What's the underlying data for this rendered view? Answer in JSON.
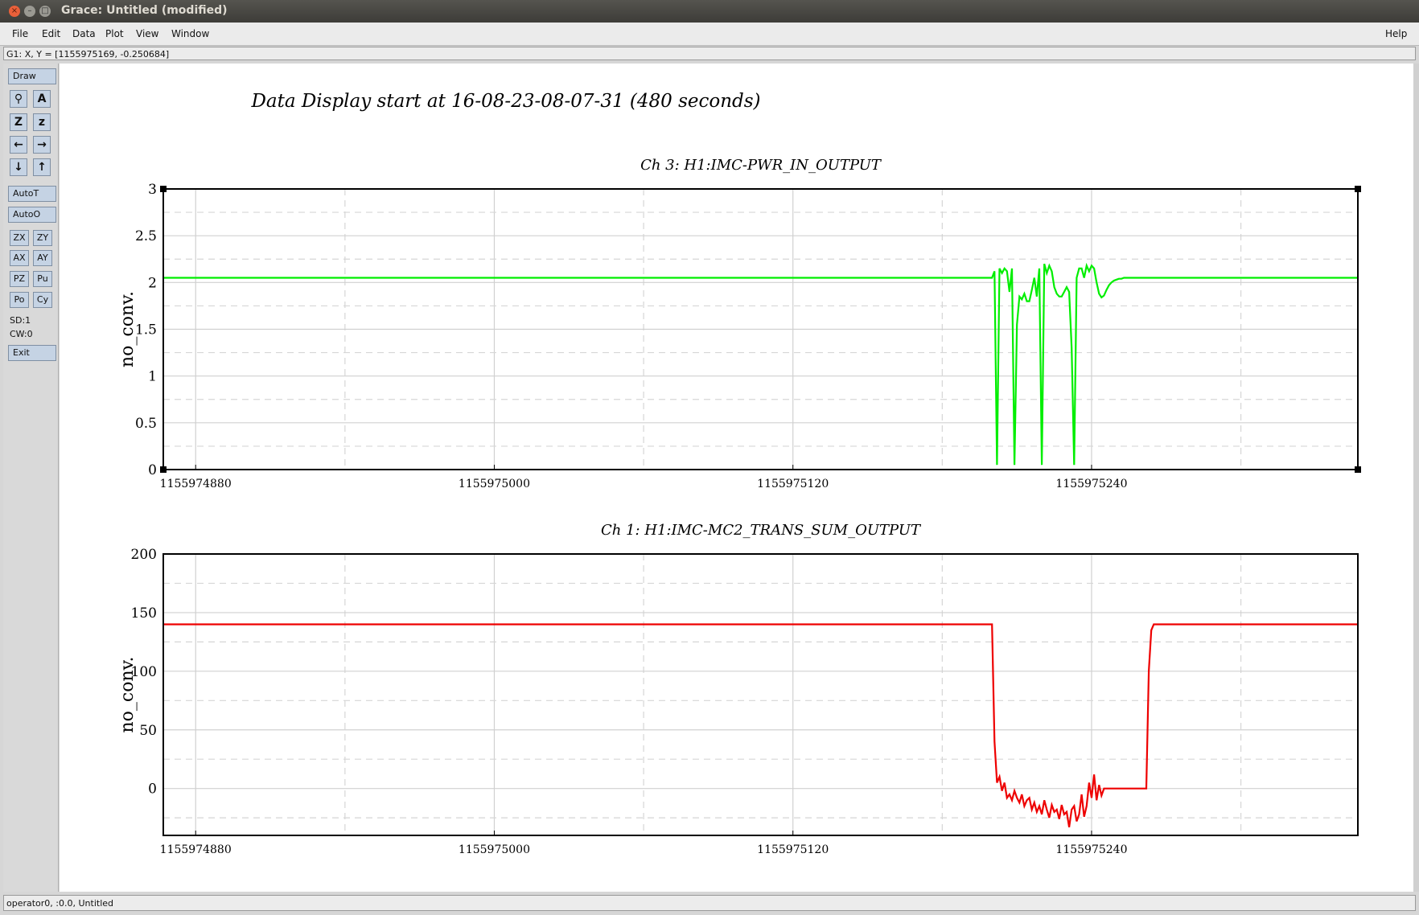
{
  "window": {
    "title": "Grace: Untitled (modified)"
  },
  "menu": {
    "items": [
      "File",
      "Edit",
      "Data",
      "Plot",
      "View",
      "Window"
    ],
    "help": "Help"
  },
  "coords": {
    "text": "G1: X, Y = [1155975169, -0.250684]"
  },
  "toolbar": {
    "draw": "Draw",
    "autot": "AutoT",
    "autoo": "AutoO",
    "small": [
      "ZX",
      "ZY",
      "AX",
      "AY",
      "PZ",
      "Pu",
      "Po",
      "Cy"
    ],
    "sd": "SD:1",
    "cw": "CW:0",
    "exit": "Exit"
  },
  "status": {
    "text": "operator0, :0.0, Untitled"
  },
  "page_title": "Data Display start at 16-08-23-08-07-31 (480 seconds)",
  "chart_data": [
    {
      "type": "line",
      "title": "Ch 3: H1:IMC-PWR_IN_OUTPUT",
      "ylabel": "no_conv.",
      "xlim": [
        1155974867,
        1155975347
      ],
      "ylim": [
        0,
        3
      ],
      "xticks": [
        1155974880,
        1155975000,
        1155975120,
        1155975240
      ],
      "yticks": [
        0,
        0.5,
        1,
        1.5,
        2,
        2.5,
        3
      ],
      "ytick_labels": [
        "0",
        "0.5",
        "1",
        "1.5",
        "2",
        "2.5",
        "3"
      ],
      "grid": true,
      "color": "#00ee00",
      "series": [
        {
          "x": [
            1155974867,
            1155975200,
            1155975201,
            1155975202,
            1155975203,
            1155975204,
            1155975205,
            1155975206,
            1155975207,
            1155975208,
            1155975209,
            1155975210,
            1155975211,
            1155975212,
            1155975213,
            1155975214,
            1155975215,
            1155975216,
            1155975217,
            1155975218,
            1155975219,
            1155975220,
            1155975221,
            1155975222,
            1155975223,
            1155975224,
            1155975225,
            1155975226,
            1155975227,
            1155975228,
            1155975229,
            1155975230,
            1155975231,
            1155975232,
            1155975233,
            1155975234,
            1155975235,
            1155975236,
            1155975237,
            1155975238,
            1155975239,
            1155975240,
            1155975241,
            1155975242,
            1155975243,
            1155975244,
            1155975245,
            1155975246,
            1155975247,
            1155975248,
            1155975249,
            1155975250,
            1155975251,
            1155975252,
            1155975253,
            1155975254,
            1155975256,
            1155975258,
            1155975261,
            1155975265,
            1155975270,
            1155975347
          ],
          "y": [
            2.05,
            2.05,
            2.12,
            0.05,
            2.15,
            2.1,
            2.15,
            2.12,
            1.9,
            2.15,
            0.05,
            1.55,
            1.85,
            1.82,
            1.88,
            1.8,
            1.8,
            1.92,
            2.05,
            1.85,
            2.15,
            0.05,
            2.2,
            2.1,
            2.18,
            2.12,
            1.95,
            1.88,
            1.85,
            1.85,
            1.9,
            1.95,
            1.9,
            1.3,
            0.05,
            2.05,
            2.15,
            2.15,
            2.05,
            2.18,
            2.12,
            2.18,
            2.15,
            2.0,
            1.88,
            1.84,
            1.86,
            1.92,
            1.97,
            2.0,
            2.02,
            2.03,
            2.04,
            2.04,
            2.05,
            2.05,
            2.05,
            2.05,
            2.05,
            2.05,
            2.05,
            2.05
          ]
        }
      ]
    },
    {
      "type": "line",
      "title": "Ch 1: H1:IMC-MC2_TRANS_SUM_OUTPUT",
      "ylabel": "no_conv.",
      "xlim": [
        1155974867,
        1155975347
      ],
      "ylim": [
        -40,
        200
      ],
      "xticks": [
        1155974880,
        1155975000,
        1155975120,
        1155975240
      ],
      "yticks": [
        0,
        50,
        100,
        150,
        200
      ],
      "ytick_labels": [
        "0",
        "50",
        "100",
        "150",
        "200"
      ],
      "grid": true,
      "color": "#ee0000",
      "series": [
        {
          "x": [
            1155974867,
            1155975200,
            1155975201,
            1155975202,
            1155975203,
            1155975204,
            1155975205,
            1155975206,
            1155975207,
            1155975208,
            1155975209,
            1155975210,
            1155975211,
            1155975212,
            1155975213,
            1155975214,
            1155975215,
            1155975216,
            1155975217,
            1155975218,
            1155975219,
            1155975220,
            1155975221,
            1155975222,
            1155975223,
            1155975224,
            1155975225,
            1155975226,
            1155975227,
            1155975228,
            1155975229,
            1155975230,
            1155975231,
            1155975232,
            1155975233,
            1155975234,
            1155975235,
            1155975236,
            1155975237,
            1155975238,
            1155975239,
            1155975240,
            1155975241,
            1155975242,
            1155975243,
            1155975244,
            1155975245,
            1155975250,
            1155975255,
            1155975260,
            1155975262,
            1155975263,
            1155975264,
            1155975265,
            1155975347
          ],
          "y": [
            140,
            140,
            40,
            5,
            10,
            -2,
            5,
            -8,
            -5,
            -10,
            -2,
            -8,
            -12,
            -5,
            -15,
            -10,
            -8,
            -18,
            -12,
            -20,
            -15,
            -22,
            -10,
            -18,
            -25,
            -14,
            -20,
            -18,
            -26,
            -14,
            -22,
            -20,
            -33,
            -18,
            -15,
            -28,
            -22,
            -5,
            -24,
            -15,
            5,
            -8,
            12,
            -10,
            3,
            -6,
            0,
            0,
            0,
            0,
            0,
            100,
            135,
            140,
            140
          ]
        }
      ]
    }
  ]
}
